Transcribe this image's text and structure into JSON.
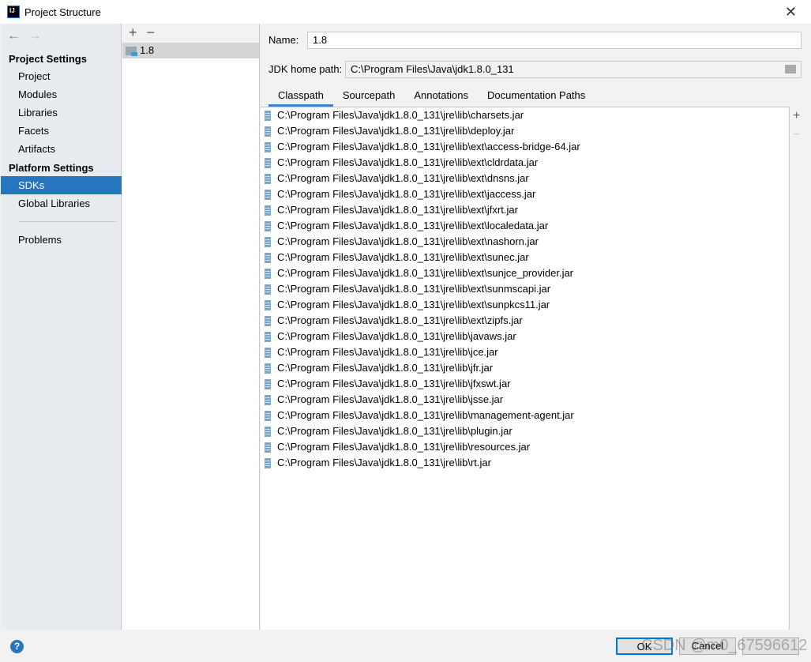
{
  "window": {
    "title": "Project Structure",
    "logo": "IJ"
  },
  "sidebar": {
    "project_settings": "Project Settings",
    "platform_settings": "Platform Settings",
    "items": [
      "Project",
      "Modules",
      "Libraries",
      "Facets",
      "Artifacts"
    ],
    "platform_items": [
      "SDKs",
      "Global Libraries"
    ],
    "problems": "Problems"
  },
  "sdk_list": {
    "items": [
      "1.8"
    ]
  },
  "form": {
    "name_label": "Name:",
    "name_value": "1.8",
    "home_label": "JDK home path:",
    "home_value": "C:\\Program Files\\Java\\jdk1.8.0_131"
  },
  "tabs": [
    "Classpath",
    "Sourcepath",
    "Annotations",
    "Documentation Paths"
  ],
  "classpath": [
    "C:\\Program Files\\Java\\jdk1.8.0_131\\jre\\lib\\charsets.jar",
    "C:\\Program Files\\Java\\jdk1.8.0_131\\jre\\lib\\deploy.jar",
    "C:\\Program Files\\Java\\jdk1.8.0_131\\jre\\lib\\ext\\access-bridge-64.jar",
    "C:\\Program Files\\Java\\jdk1.8.0_131\\jre\\lib\\ext\\cldrdata.jar",
    "C:\\Program Files\\Java\\jdk1.8.0_131\\jre\\lib\\ext\\dnsns.jar",
    "C:\\Program Files\\Java\\jdk1.8.0_131\\jre\\lib\\ext\\jaccess.jar",
    "C:\\Program Files\\Java\\jdk1.8.0_131\\jre\\lib\\ext\\jfxrt.jar",
    "C:\\Program Files\\Java\\jdk1.8.0_131\\jre\\lib\\ext\\localedata.jar",
    "C:\\Program Files\\Java\\jdk1.8.0_131\\jre\\lib\\ext\\nashorn.jar",
    "C:\\Program Files\\Java\\jdk1.8.0_131\\jre\\lib\\ext\\sunec.jar",
    "C:\\Program Files\\Java\\jdk1.8.0_131\\jre\\lib\\ext\\sunjce_provider.jar",
    "C:\\Program Files\\Java\\jdk1.8.0_131\\jre\\lib\\ext\\sunmscapi.jar",
    "C:\\Program Files\\Java\\jdk1.8.0_131\\jre\\lib\\ext\\sunpkcs11.jar",
    "C:\\Program Files\\Java\\jdk1.8.0_131\\jre\\lib\\ext\\zipfs.jar",
    "C:\\Program Files\\Java\\jdk1.8.0_131\\jre\\lib\\javaws.jar",
    "C:\\Program Files\\Java\\jdk1.8.0_131\\jre\\lib\\jce.jar",
    "C:\\Program Files\\Java\\jdk1.8.0_131\\jre\\lib\\jfr.jar",
    "C:\\Program Files\\Java\\jdk1.8.0_131\\jre\\lib\\jfxswt.jar",
    "C:\\Program Files\\Java\\jdk1.8.0_131\\jre\\lib\\jsse.jar",
    "C:\\Program Files\\Java\\jdk1.8.0_131\\jre\\lib\\management-agent.jar",
    "C:\\Program Files\\Java\\jdk1.8.0_131\\jre\\lib\\plugin.jar",
    "C:\\Program Files\\Java\\jdk1.8.0_131\\jre\\lib\\resources.jar",
    "C:\\Program Files\\Java\\jdk1.8.0_131\\jre\\lib\\rt.jar"
  ],
  "buttons": {
    "ok": "OK",
    "cancel": "Cancel",
    "help": "?"
  },
  "watermark": "CSDN @m0_67596612"
}
